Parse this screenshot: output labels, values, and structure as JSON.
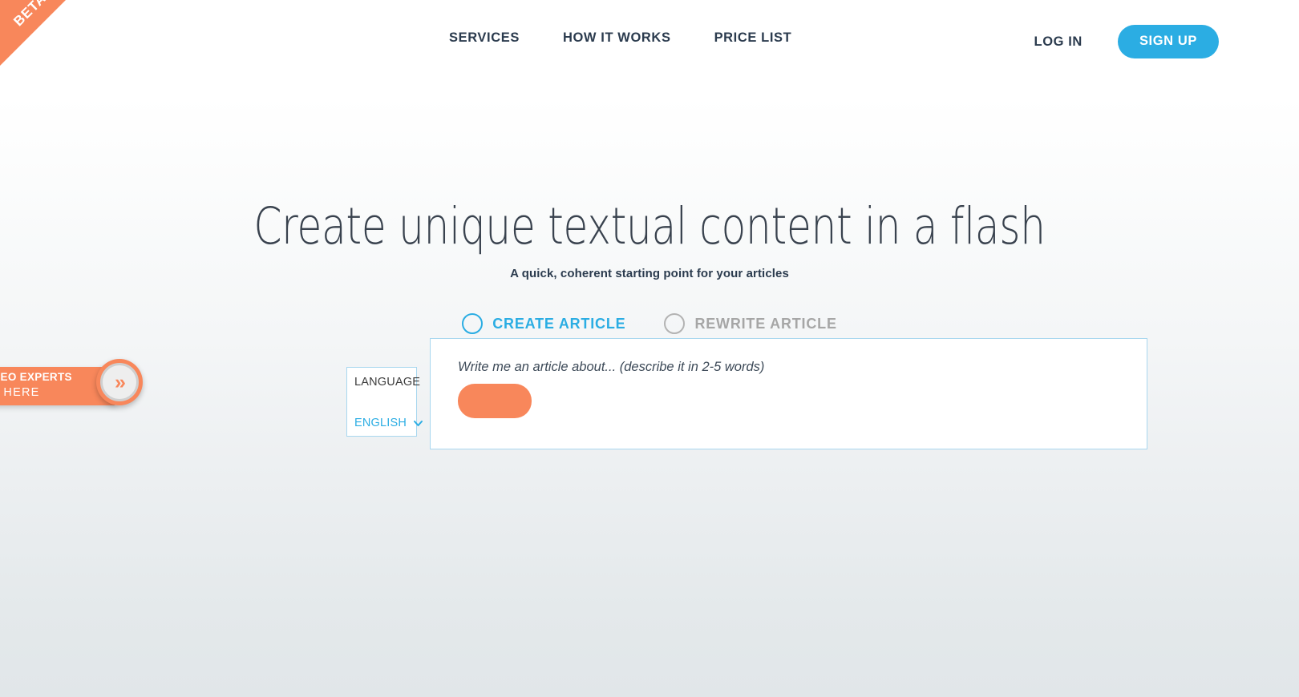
{
  "ribbon": {
    "label": "BETA"
  },
  "header": {
    "nav": [
      {
        "label": "SERVICES",
        "name": "nav-link-services"
      },
      {
        "label": "HOW IT WORKS",
        "name": "nav-link-how-it-works"
      },
      {
        "label": "PRICE LIST",
        "name": "nav-link-price-list"
      }
    ],
    "login_label": "LOG IN",
    "signup_label": "SIGN UP"
  },
  "hero": {
    "title": "Create unique textual content in a flash",
    "subtitle": "A quick, coherent starting point for your articles"
  },
  "modes": [
    {
      "label": "CREATE ARTICLE",
      "selected": true
    },
    {
      "label": "REWRITE ARTICLE",
      "selected": false
    }
  ],
  "language": {
    "label": "LANGUAGE",
    "value": "ENGLISH",
    "options": [
      "ENGLISH"
    ],
    "chevron_icon": "chevron-down-icon"
  },
  "prompt": {
    "placeholder": "Write me an article about... (describe it in 2-5 words)",
    "value": "",
    "generate_label": ""
  },
  "promo": {
    "line1": "GENCIES & SEO EXPERTS",
    "line2": "CLICK HERE",
    "arrow_icon": "double-chevron-right-icon",
    "arrow_glyph": "»"
  },
  "colors": {
    "accent_blue": "#2bade3",
    "accent_orange": "#f8875b",
    "text_dark": "#2b3b4e",
    "muted_gray": "#a6a6a6",
    "panel_border": "#a8d7ef",
    "bg_top": "#ffffff",
    "bg_bottom": "#e1e6e9"
  }
}
